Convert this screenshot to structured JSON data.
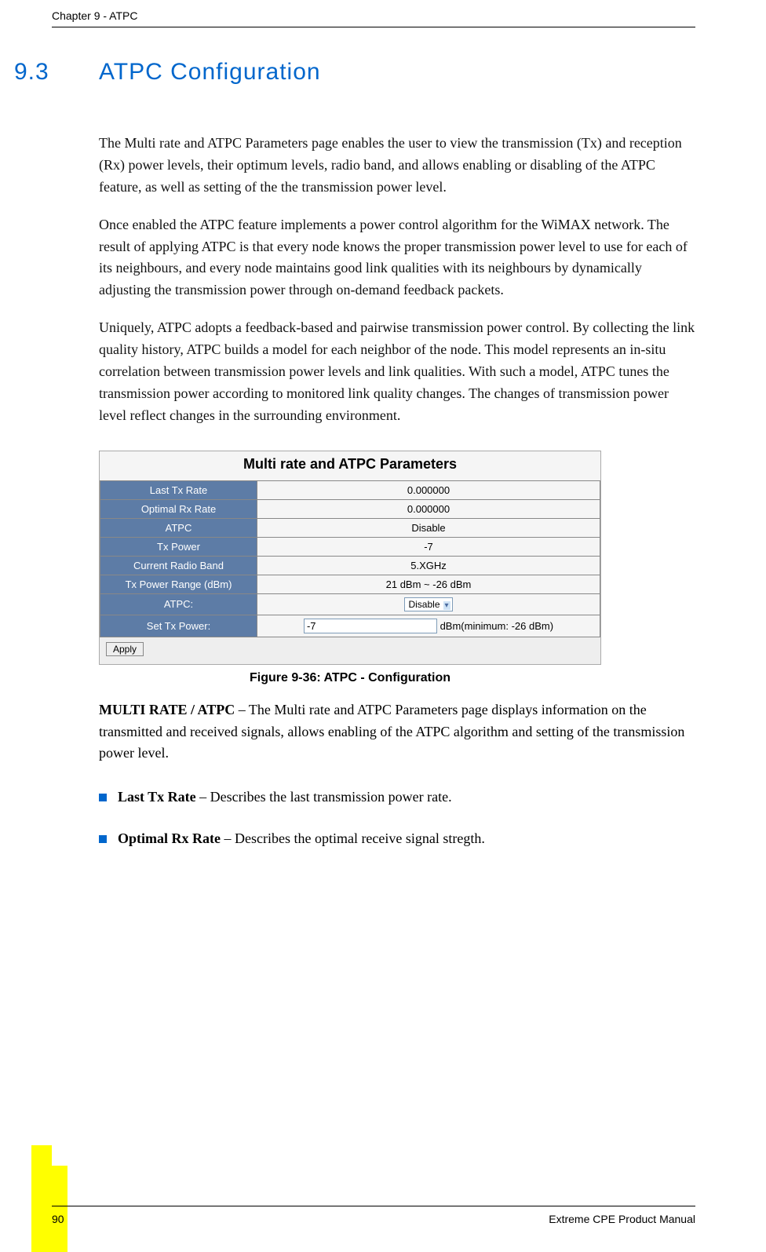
{
  "header": {
    "chapter": "Chapter 9 - ATPC"
  },
  "section": {
    "number": "9.3",
    "title": "ATPC Configuration"
  },
  "paragraphs": {
    "p1": "The Multi rate and ATPC Parameters page enables the user to view the transmission (Tx) and reception (Rx) power levels, their optimum levels, radio band, and allows enabling or disabling of the ATPC feature, as well as setting of the the transmission power level.",
    "p2": "Once enabled the ATPC feature implements a power control algorithm for the WiMAX network. The result of applying ATPC is that every node knows the proper transmission power level to use for each of its neighbours, and every node maintains good link qualities with its neighbours by dynamically adjusting the transmission power through on-demand feedback packets.",
    "p3": "Uniquely, ATPC adopts a feedback-based and pairwise transmission power control. By collecting the link quality history, ATPC builds a model for each neighbor of the node. This model represents an in-situ correlation between transmission power levels and link qualities. With such a model, ATPC tunes the transmission power according to monitored link quality changes. The changes of transmission power level reflect changes in the surrounding environment."
  },
  "panel": {
    "title": "Multi rate and ATPC Parameters",
    "rows": {
      "r1": {
        "label": "Last Tx Rate",
        "value": "0.000000"
      },
      "r2": {
        "label": "Optimal Rx Rate",
        "value": "0.000000"
      },
      "r3": {
        "label": "ATPC",
        "value": "Disable"
      },
      "r4": {
        "label": "Tx Power",
        "value": "-7"
      },
      "r5": {
        "label": "Current Radio Band",
        "value": "5.XGHz"
      },
      "r6": {
        "label": "Tx Power Range (dBm)",
        "value": "21 dBm ~ -26 dBm"
      },
      "r7": {
        "label": "ATPC:",
        "select_value": "Disable"
      },
      "r8": {
        "label": "Set Tx Power:",
        "input_value": "-7",
        "suffix": " dBm(minimum: -26 dBm)"
      }
    },
    "apply": "Apply"
  },
  "figure_caption": "Figure 9-36: ATPC - Configuration",
  "terms": {
    "multi": {
      "bold": "MULTI RATE / ATPC",
      "rest": " – The Multi rate and ATPC Parameters page displays information on the transmitted and received signals, allows enabling of the ATPC algorithm and setting of the transmission power level."
    }
  },
  "bullets": {
    "b1": {
      "bold": "Last Tx Rate",
      "rest": " – Describes the last transmission power rate."
    },
    "b2": {
      "bold": "Optimal Rx Rate",
      "rest": " – Describes the optimal receive signal stregth."
    }
  },
  "footer": {
    "page": "90",
    "manual": "Extreme CPE Product Manual"
  }
}
